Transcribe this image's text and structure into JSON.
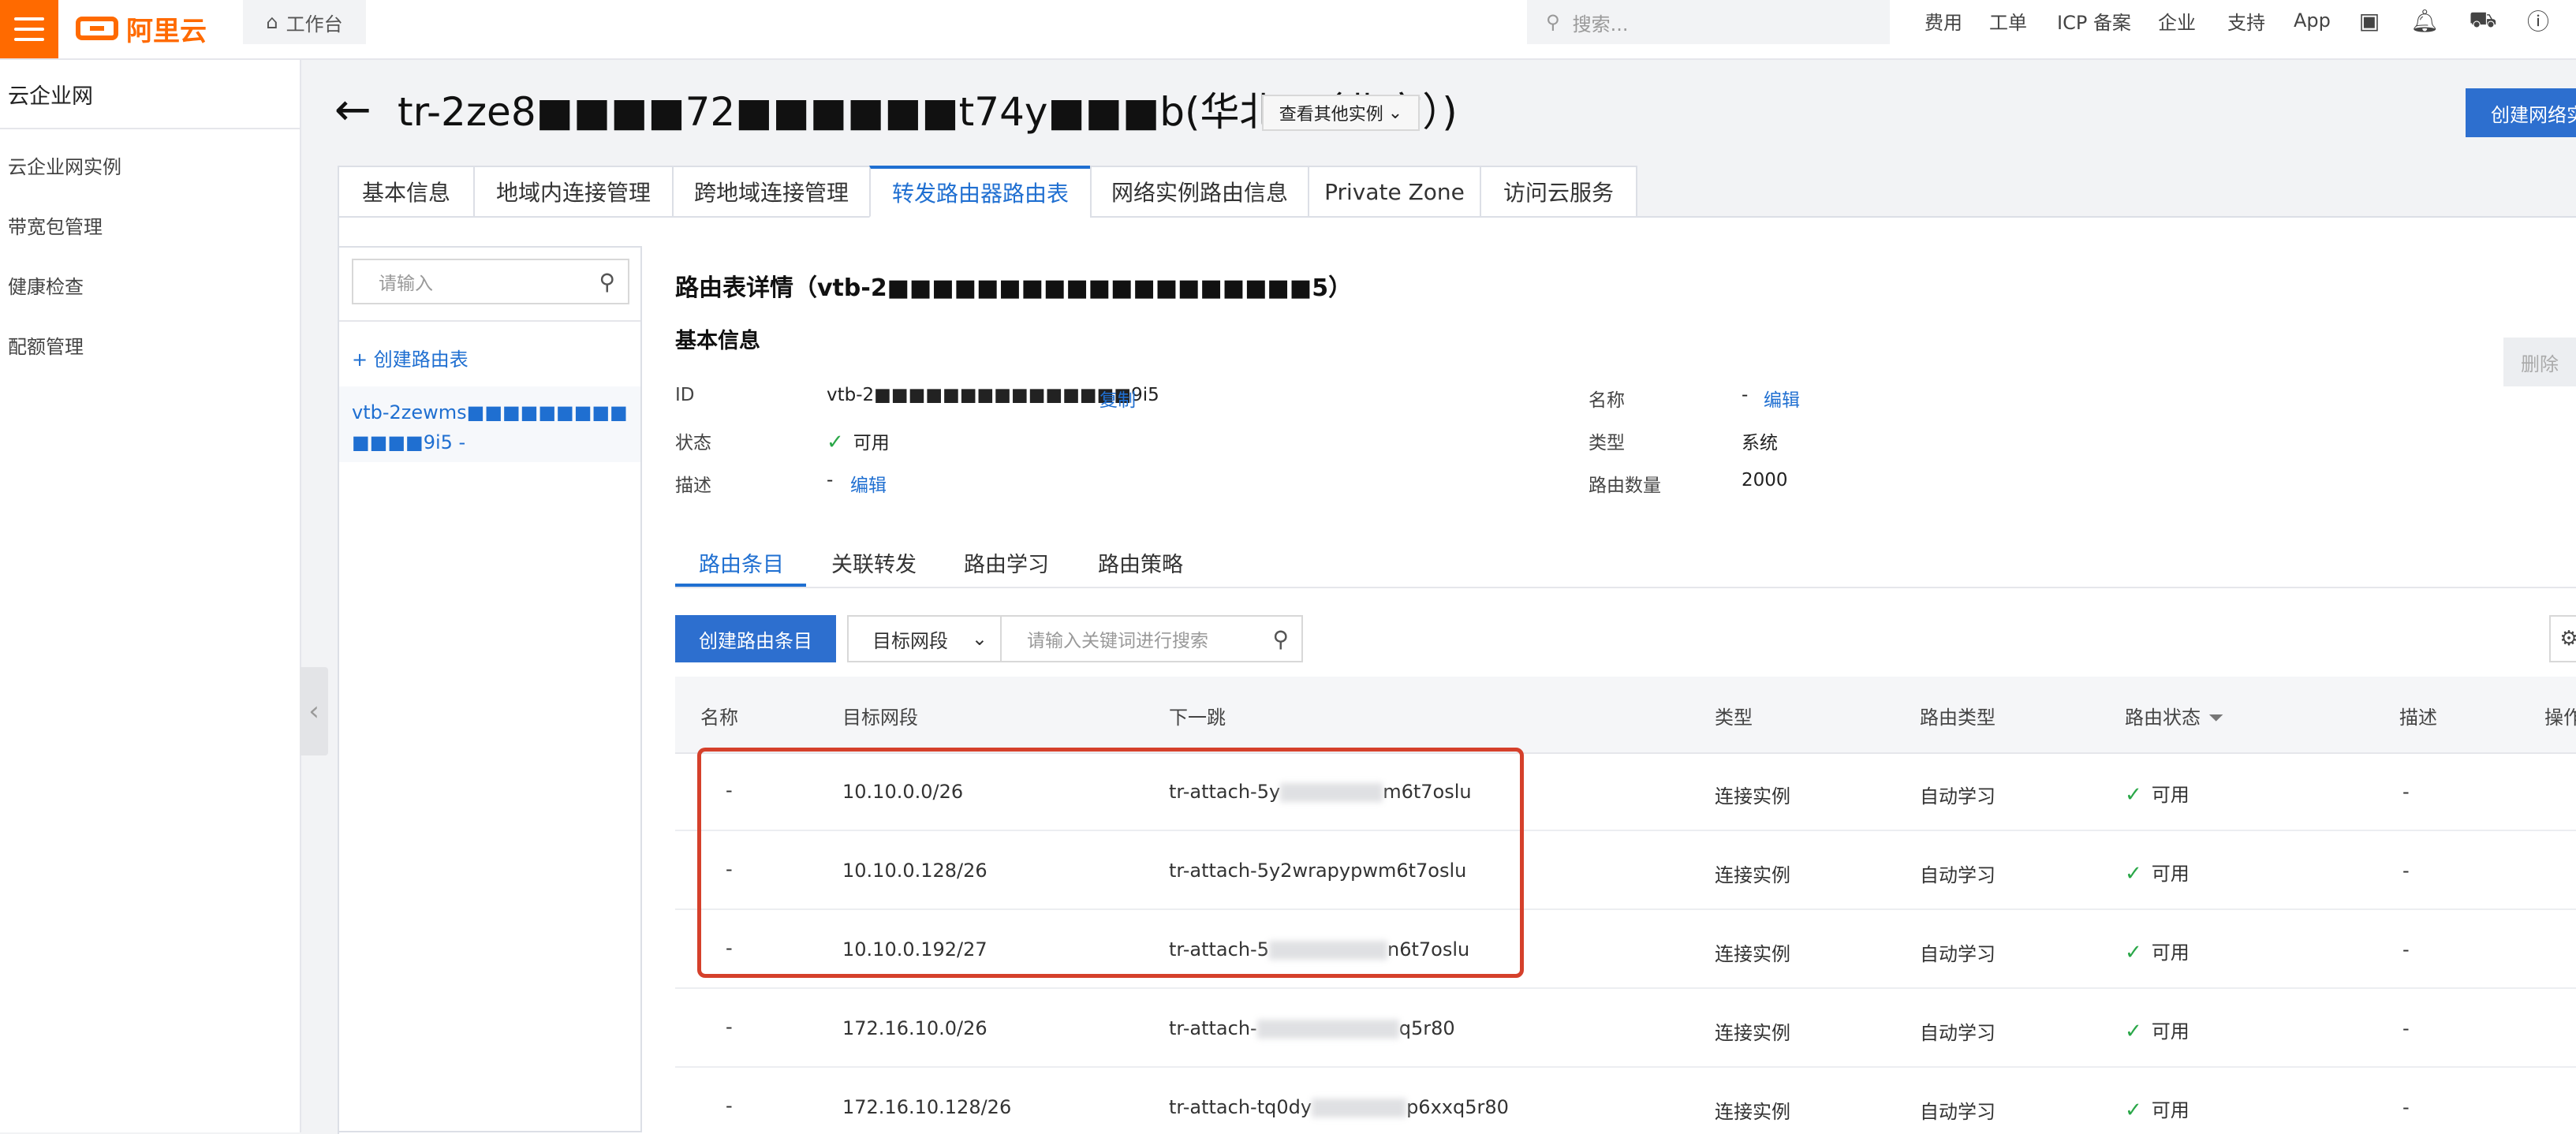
{
  "topbar": {
    "brand": "阿里云",
    "workbench": "工作台",
    "search_placeholder": "搜索...",
    "nav": [
      "费用",
      "工单",
      "ICP 备案",
      "企业",
      "支持",
      "App"
    ],
    "icons": [
      "terminal-icon",
      "bell-icon",
      "cart-icon",
      "help-icon"
    ],
    "brand_color": "#ff6a00"
  },
  "sidebar": {
    "title": "云企业网",
    "items": [
      "云企业网实例",
      "带宽包管理",
      "健康检查",
      "配额管理"
    ]
  },
  "header": {
    "title": "tr-2ze8■■■■72■■■■■■t74y■■■b(华北2（北京）)",
    "other_instances": "查看其他实例",
    "create_button": "创建网络实"
  },
  "tabs": [
    "基本信息",
    "地域内连接管理",
    "跨地域连接管理",
    "转发路由器路由表",
    "网络实例路由信息",
    "Private Zone",
    "访问云服务"
  ],
  "route_tables": {
    "search_placeholder": "请输入",
    "create_label": "创建路由表",
    "item": "vtb-2zewms■■■■■■■■■■■■■9i5 -"
  },
  "detail": {
    "title": "路由表详情（vtb-2■■■■■■■■■■■■■■■■■■■5）",
    "basic_title": "基本信息",
    "id_label": "ID",
    "id_value": "vtb-2■■■■■■■■■■■■■■■9i5",
    "copy": "复制",
    "status_label": "状态",
    "status_value": "可用",
    "desc_label": "描述",
    "desc_value": "-",
    "edit": "编辑",
    "name_label": "名称",
    "name_value": "-",
    "type_label": "类型",
    "type_value": "系统",
    "count_label": "路由数量",
    "count_value": "2000",
    "delete": "删除"
  },
  "subtabs": [
    "路由条目",
    "关联转发",
    "路由学习",
    "路由策略"
  ],
  "toolbar": {
    "create_entry": "创建路由条目",
    "field_select": "目标网段",
    "search_placeholder": "请输入关键词进行搜索"
  },
  "table": {
    "headers": [
      "名称",
      "目标网段",
      "下一跳",
      "类型",
      "路由类型",
      "路由状态",
      "描述",
      "操作"
    ],
    "rows": [
      {
        "name": "-",
        "cidr": "10.10.0.0/26",
        "hop_a": "tr-attach-5y",
        "hop_b": "m6t7oslu",
        "type": "连接实例",
        "route_type": "自动学习",
        "status": "可用",
        "desc": "-"
      },
      {
        "name": "-",
        "cidr": "10.10.0.128/26",
        "hop_a": "tr-attach-5y2wrapypwm6t7oslu",
        "hop_b": "",
        "type": "连接实例",
        "route_type": "自动学习",
        "status": "可用",
        "desc": "-"
      },
      {
        "name": "-",
        "cidr": "10.10.0.192/27",
        "hop_a": "tr-attach-5",
        "hop_b": "n6t7oslu",
        "type": "连接实例",
        "route_type": "自动学习",
        "status": "可用",
        "desc": "-"
      },
      {
        "name": "-",
        "cidr": "172.16.10.0/26",
        "hop_a": "tr-attach-",
        "hop_b": "q5r80",
        "type": "连接实例",
        "route_type": "自动学习",
        "status": "可用",
        "desc": "-"
      },
      {
        "name": "-",
        "cidr": "172.16.10.128/26",
        "hop_a": "tr-attach-tq0dy",
        "hop_b": "p6xxq5r80",
        "type": "连接实例",
        "route_type": "自动学习",
        "status": "可用",
        "desc": "-"
      }
    ]
  }
}
